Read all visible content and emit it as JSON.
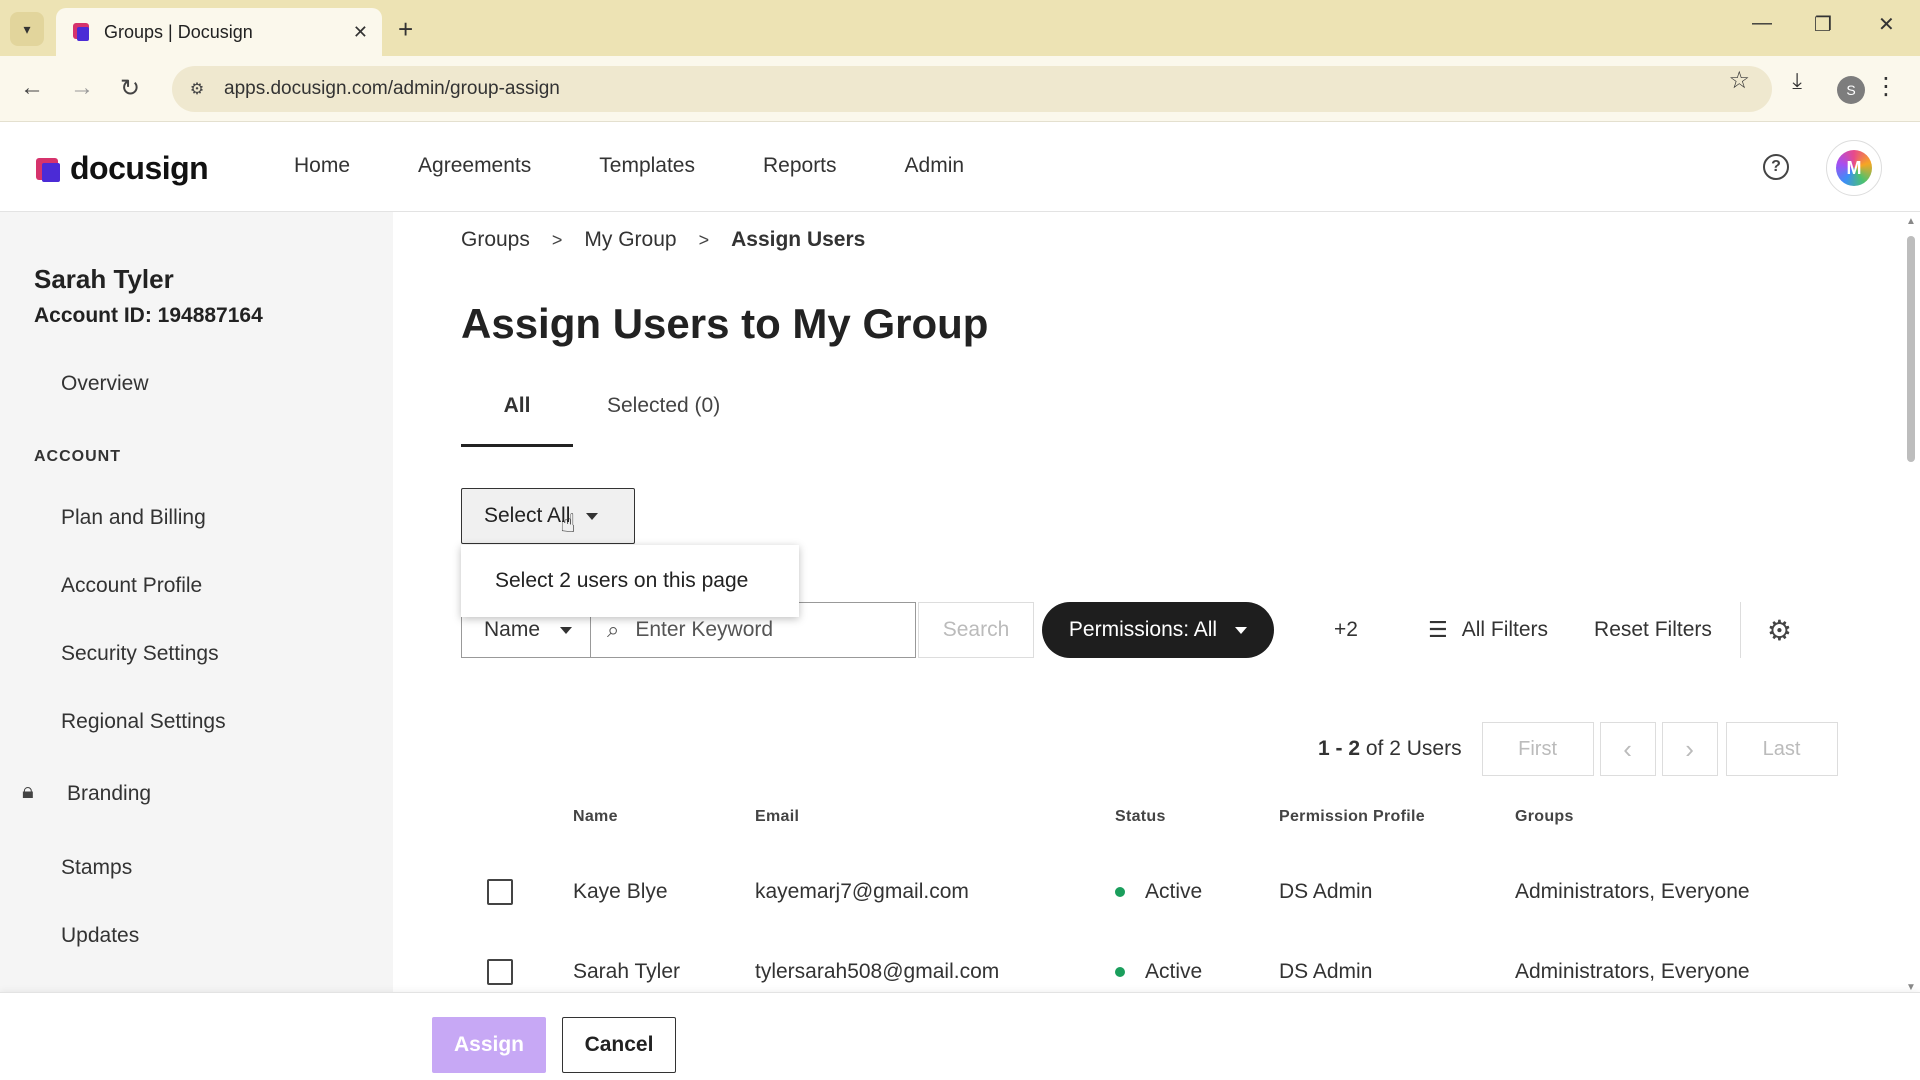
{
  "browser": {
    "tab_title": "Groups | Docusign",
    "url": "apps.docusign.com/admin/group-assign",
    "profile_initial": "S"
  },
  "header": {
    "logo_text": "docusign",
    "nav": [
      "Home",
      "Agreements",
      "Templates",
      "Reports",
      "Admin"
    ],
    "avatar_initial": "M"
  },
  "sidebar": {
    "user_name": "Sarah Tyler",
    "account_id": "Account ID: 194887164",
    "overview": "Overview",
    "section_label": "ACCOUNT",
    "items": [
      "Plan and Billing",
      "Account Profile",
      "Security Settings",
      "Regional Settings",
      "Branding",
      "Stamps",
      "Updates"
    ]
  },
  "breadcrumb": [
    "Groups",
    "My Group",
    "Assign Users"
  ],
  "page_title": "Assign Users to My Group",
  "tabs": {
    "all": "All",
    "selected": "Selected (0)"
  },
  "select_all": {
    "label": "Select All",
    "dropdown_option": "Select 2 users on this page"
  },
  "filters": {
    "field": "Name",
    "keyword_placeholder": "Enter Keyword",
    "search": "Search",
    "permissions": "Permissions: All",
    "more": "+2",
    "all_filters": "All Filters",
    "reset": "Reset Filters"
  },
  "pager": {
    "range": "1 - 2",
    "of_text": "of 2 Users",
    "first": "First",
    "last": "Last"
  },
  "table": {
    "headers": [
      "Name",
      "Email",
      "Status",
      "Permission Profile",
      "Groups"
    ],
    "rows": [
      {
        "name": "Kaye Blye",
        "email": "kayemarj7@gmail.com",
        "status": "Active",
        "profile": "DS Admin",
        "groups": "Administrators, Everyone"
      },
      {
        "name": "Sarah Tyler",
        "email": "tylersarah508@gmail.com",
        "status": "Active",
        "profile": "DS Admin",
        "groups": "Administrators, Everyone"
      }
    ]
  },
  "footer": {
    "assign": "Assign",
    "cancel": "Cancel"
  },
  "colors": {
    "accent_purple": "#c7a8f5",
    "status_active": "#1a9e5c",
    "tabbar": "#ede3b4"
  }
}
